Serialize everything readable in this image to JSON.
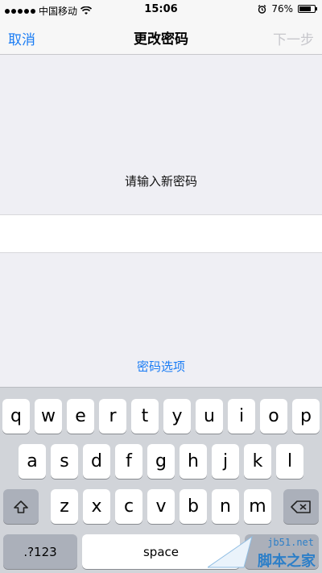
{
  "status_bar": {
    "carrier": "中国移动",
    "time": "15:06",
    "battery_percent": "76%",
    "battery_level": 0.76
  },
  "nav": {
    "cancel_label": "取消",
    "title": "更改密码",
    "next_label": "下一步"
  },
  "prompt": "请输入新密码",
  "password_field": {
    "value": ""
  },
  "options_link": "密码选项",
  "keyboard": {
    "row1": [
      "q",
      "w",
      "e",
      "r",
      "t",
      "y",
      "u",
      "i",
      "o",
      "p"
    ],
    "row2": [
      "a",
      "s",
      "d",
      "f",
      "g",
      "h",
      "j",
      "k",
      "l"
    ],
    "row3": [
      "z",
      "x",
      "c",
      "v",
      "b",
      "n",
      "m"
    ],
    "numbers_label": ".?123",
    "space_label": "space",
    "shift_icon": "shift-icon",
    "delete_icon": "delete-icon"
  },
  "watermark": {
    "domain": "jb51.net",
    "text": "脚本之家"
  }
}
